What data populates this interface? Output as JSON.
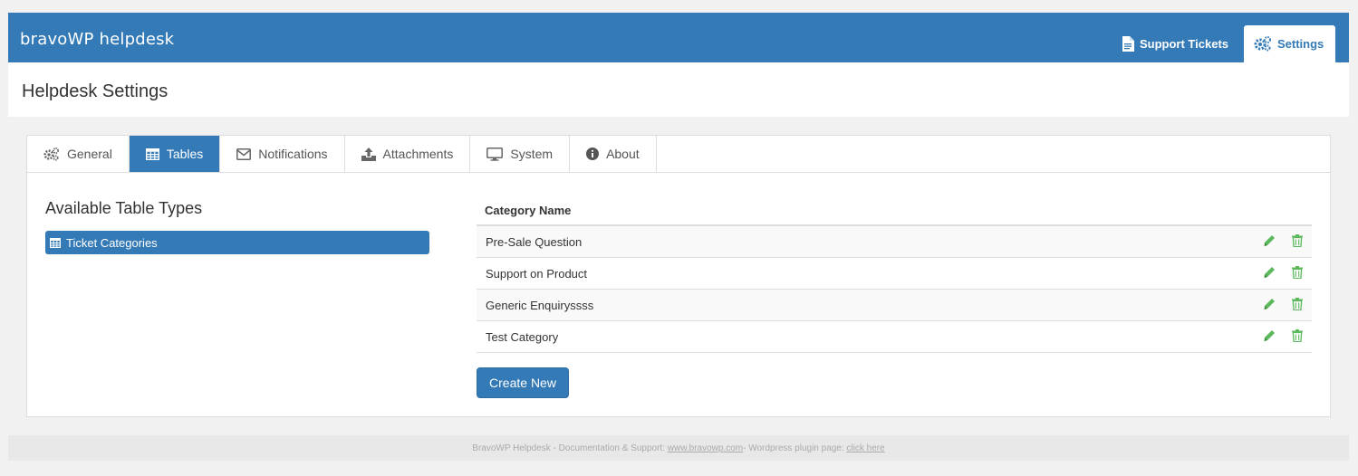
{
  "app": {
    "brand": "bravoWP helpdesk"
  },
  "nav": {
    "support_tickets": "Support Tickets",
    "settings": "Settings"
  },
  "page": {
    "title": "Helpdesk Settings"
  },
  "tabs": [
    {
      "label": "General",
      "icon": "gears-icon"
    },
    {
      "label": "Tables",
      "icon": "table-icon",
      "active": true
    },
    {
      "label": "Notifications",
      "icon": "envelope-icon"
    },
    {
      "label": "Attachments",
      "icon": "upload-icon"
    },
    {
      "label": "System",
      "icon": "monitor-icon"
    },
    {
      "label": "About",
      "icon": "info-icon"
    }
  ],
  "left": {
    "title": "Available Table Types",
    "types": [
      {
        "label": "Ticket Categories",
        "icon": "table-icon"
      }
    ]
  },
  "table": {
    "header": "Category Name",
    "rows": [
      {
        "name": "Pre-Sale Question"
      },
      {
        "name": "Support on Product"
      },
      {
        "name": "Generic Enquiryssss"
      },
      {
        "name": "Test Category"
      }
    ]
  },
  "create_button": "Create New",
  "footer": {
    "prefix": "BravoWP Helpdesk - Documentation & Support: ",
    "link1": "www.bravowp.com",
    "middle": " - Wordpress plugin page: ",
    "link2": "click here"
  },
  "colors": {
    "primary": "#337ab7",
    "action_green": "#5cb85c"
  }
}
